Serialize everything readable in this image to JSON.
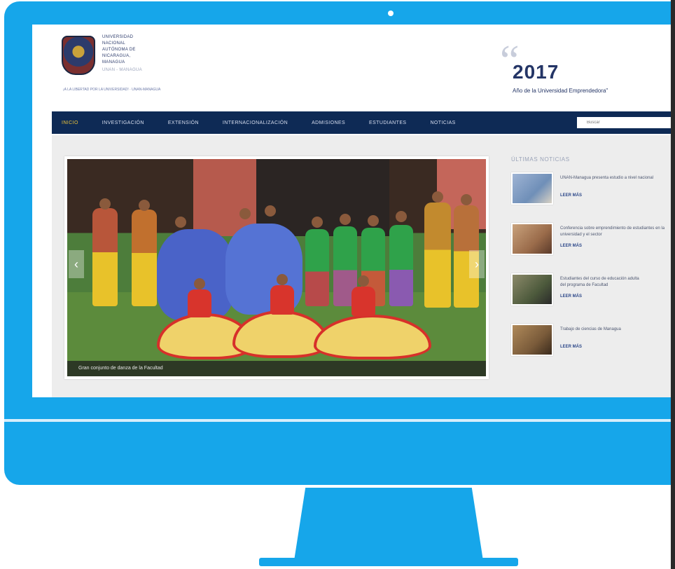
{
  "header": {
    "university_name_lines": [
      "UNIVERSIDAD",
      "NACIONAL",
      "AUTÓNOMA DE",
      "NICARAGUA,",
      "MANAGUA"
    ],
    "university_sub": "UNAN - MANAGUA",
    "tagline": "¡A LA LIBERTAD POR LA UNIVERSIDAD! · UNAN-MANAGUA",
    "year": "2017",
    "year_subtitle": "Año de la Universidad Emprendedora\""
  },
  "nav": {
    "items": [
      "INICIO",
      "INVESTIGACIÓN",
      "EXTENSIÓN",
      "INTERNACIONALIZACIÓN",
      "ADMISIONES",
      "ESTUDIANTES",
      "NOTICIAS"
    ],
    "active_index": 0,
    "search_placeholder": "Buscar"
  },
  "slider": {
    "caption": "Gran conjunto de danza de la Facultad"
  },
  "sidebar": {
    "title": "ÚLTIMAS NOTICIAS",
    "news": [
      {
        "title": "UNAN-Managua presenta estudio a nivel nacional",
        "more": "LEER MÁS",
        "thumb_color": "#6f8fb8"
      },
      {
        "title": "Conferencia sobre emprendimiento de estudiantes en la",
        "title2": "universidad y el sector",
        "more": "LEER MÁS",
        "thumb_color": "#9a6b4a"
      },
      {
        "title": "Estudiantes del curso de educación adulta",
        "title2": "del programa de Facultad",
        "more": "LEER MÁS",
        "thumb_color": "#4d5a3c"
      },
      {
        "title": "Trabajo de ciencias de Managua",
        "more": "LEER MÁS",
        "thumb_color": "#7a5b3a"
      }
    ]
  },
  "colors": {
    "monitor": "#16a6ea",
    "nav_bg": "#0e2a55",
    "nav_active": "#e9c23b",
    "brand_text": "#243566"
  }
}
